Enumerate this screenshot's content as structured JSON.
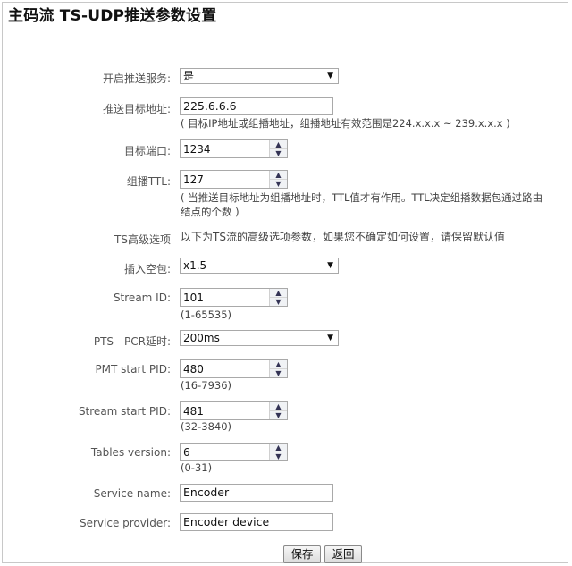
{
  "page": {
    "title": "主码流 TS-UDP推送参数设置"
  },
  "fields": {
    "push_service": {
      "label": "开启推送服务:",
      "value": "是"
    },
    "target_addr": {
      "label": "推送目标地址:",
      "value": "225.6.6.6",
      "hint": "( 目标IP地址或组播地址，组播地址有效范围是224.x.x.x ~ 239.x.x.x )"
    },
    "target_port": {
      "label": "目标端口:",
      "value": "1234"
    },
    "multicast_ttl": {
      "label": "组播TTL:",
      "value": "127",
      "hint": "( 当推送目标地址为组播地址时，TTL值才有作用。TTL决定组播数据包通过路由结点的个数 )"
    },
    "advanced": {
      "label": "TS高级选项",
      "text": "以下为TS流的高级选项参数，如果您不确定如何设置，请保留默认值"
    },
    "insert_null": {
      "label": "插入空包:",
      "value": "x1.5"
    },
    "stream_id": {
      "label": "Stream ID:",
      "value": "101",
      "range": "(1-65535)"
    },
    "pts_pcr_delay": {
      "label": "PTS - PCR延时:",
      "value": "200ms"
    },
    "pmt_pid": {
      "label": "PMT start PID:",
      "value": "480",
      "range": "(16-7936)"
    },
    "stream_pid": {
      "label": "Stream start PID:",
      "value": "481",
      "range": "(32-3840)"
    },
    "tables_version": {
      "label": "Tables version:",
      "value": "6",
      "range": "(0-31)"
    },
    "service_name": {
      "label": "Service name:",
      "value": "Encoder"
    },
    "service_provider": {
      "label": "Service provider:",
      "value": "Encoder device"
    }
  },
  "buttons": {
    "save": "保存",
    "back": "返回"
  },
  "icons": {
    "select_arrow": "▼",
    "spin_up": "▲",
    "spin_down": "▼"
  }
}
